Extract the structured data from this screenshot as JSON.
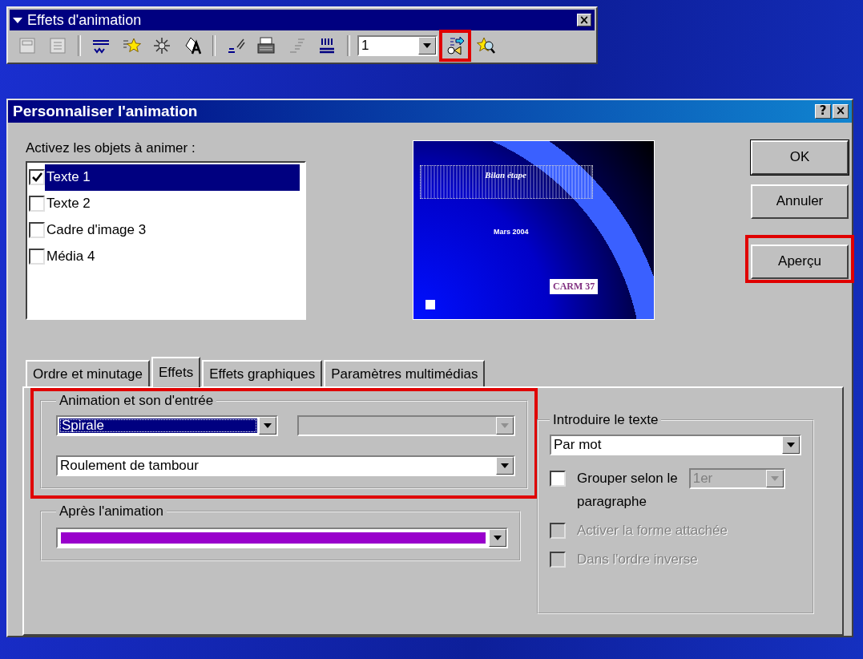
{
  "toolbar": {
    "title": "Effets d'animation",
    "close": "×",
    "buttons": [
      {
        "kind": "frame",
        "disabled": true
      },
      {
        "kind": "list",
        "disabled": true
      },
      {
        "kind": "separator"
      },
      {
        "kind": "wave",
        "disabled": false
      },
      {
        "kind": "star",
        "disabled": false
      },
      {
        "kind": "burst",
        "disabled": false
      },
      {
        "kind": "shape",
        "disabled": false
      },
      {
        "kind": "separator"
      },
      {
        "kind": "pen",
        "disabled": false
      },
      {
        "kind": "typewriter",
        "disabled": false
      },
      {
        "kind": "steps",
        "disabled": true
      },
      {
        "kind": "columns",
        "disabled": false
      },
      {
        "kind": "separator"
      },
      {
        "kind": "combo",
        "value": "1"
      },
      {
        "kind": "sound",
        "disabled": false,
        "highlighted": true
      },
      {
        "kind": "magnifier",
        "disabled": false
      }
    ]
  },
  "dialog": {
    "title": "Personnaliser l'animation",
    "help": "?",
    "close": "×",
    "objects_label": "Activez les objets à animer :",
    "objects": [
      {
        "label": "Texte 1",
        "checked": true,
        "selected": true
      },
      {
        "label": "Texte 2",
        "checked": false,
        "selected": false
      },
      {
        "label": "Cadre d'image 3",
        "checked": false,
        "selected": false
      },
      {
        "label": "Média 4",
        "checked": false,
        "selected": false
      }
    ],
    "preview": {
      "title": "Bilan étape",
      "subtitle": "Mars 2004",
      "logo": "CARM 37"
    },
    "buttons": [
      {
        "label": "OK"
      },
      {
        "label": "Annuler"
      },
      {
        "label": "Aperçu",
        "highlighted": true
      }
    ],
    "tabs": [
      {
        "label": "Ordre et minutage",
        "selected": false
      },
      {
        "label": "Effets",
        "selected": true
      },
      {
        "label": "Effets graphiques",
        "selected": false
      },
      {
        "label": "Paramètres multimédias",
        "selected": false
      }
    ],
    "entry_group": {
      "title": "Animation et son d'entrée",
      "highlighted": true,
      "effect": {
        "value": "Spirale",
        "focused": true,
        "disabled": false
      },
      "direction": {
        "disabled": true
      },
      "sound": {
        "value": "Roulement de tambour",
        "disabled": false
      }
    },
    "after_group": {
      "title": "Après l'animation",
      "color": "#9900cc"
    },
    "text_group": {
      "title": "Introduire le texte",
      "mode": {
        "value": "Par mot",
        "disabled": false
      },
      "options": [
        {
          "kind": "group",
          "label": "Grouper selon le",
          "label_end": "paragraphe",
          "checked": false,
          "disabled": false,
          "level_value": "1er",
          "level_disabled": true
        },
        {
          "kind": "checkbox",
          "label": "Activer la forme attachée",
          "checked": false,
          "disabled": true
        },
        {
          "kind": "checkbox",
          "label": "Dans l'ordre inverse",
          "checked": false,
          "disabled": true
        }
      ]
    }
  }
}
